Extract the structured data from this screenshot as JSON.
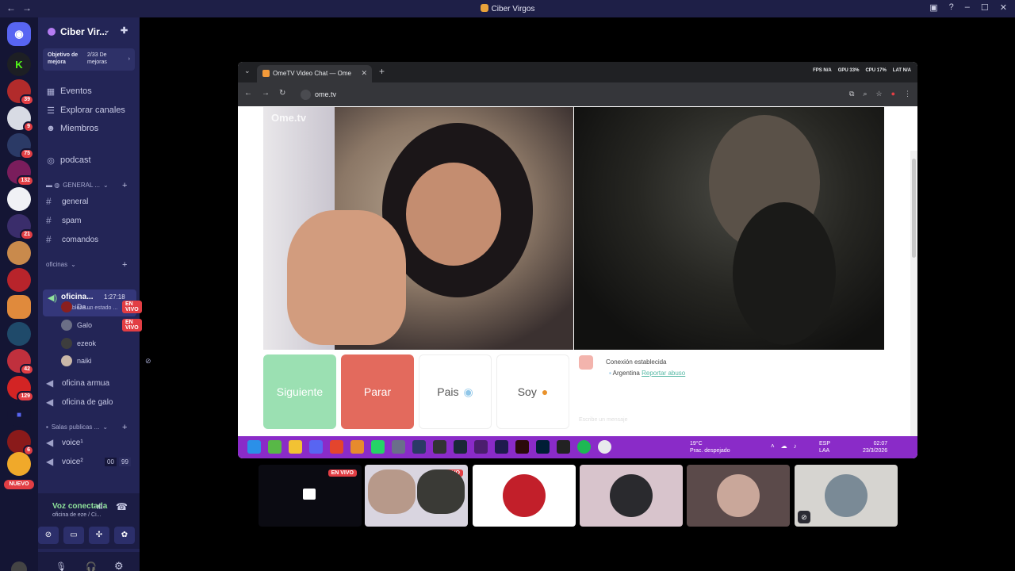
{
  "titlebar": {
    "title": "Ciber Virgos"
  },
  "rail": {
    "badges": [
      "39",
      "9",
      "75",
      "132",
      "21",
      "42",
      "129",
      "6"
    ],
    "nuevo": "NUEVO"
  },
  "sidebar": {
    "server_name": "Ciber Vir...",
    "goal": {
      "label": "Objetivo de mejora",
      "progress": "2/33 De mejoras"
    },
    "nav": [
      {
        "label": "Eventos"
      },
      {
        "label": "Explorar canales"
      },
      {
        "label": "Miembros"
      }
    ],
    "podcast": "podcast",
    "category_general": "GENERAL ...",
    "text_channels": [
      "general",
      "spam",
      "comandos"
    ],
    "category_oficinas": "oficinas",
    "active_voice": {
      "name": "oficina...",
      "time": "1:27:18",
      "status": "Establece un estado ..."
    },
    "voice_users": [
      {
        "name": "Da...",
        "live": "EN VIVO"
      },
      {
        "name": "Galo",
        "live": "EN VIVO"
      },
      {
        "name": "ezeok",
        "live": ""
      },
      {
        "name": "naiki",
        "live": ""
      }
    ],
    "voice_channels": [
      "oficina armua",
      "oficina de galo"
    ],
    "category_salas": "Salas publicas ...",
    "salas": [
      "voice¹",
      "voice²"
    ],
    "sala_counts": [
      "00",
      "99"
    ],
    "voicebar": {
      "status": "Voz conectada",
      "channel": "oficina de eze / Ci..."
    }
  },
  "browser": {
    "tab_title": "OmeTV Video Chat — Ome",
    "url": "ome.tv",
    "perf": [
      "FPS N/A",
      "GPU 33%",
      "CPU 17%",
      "LAT N/A"
    ],
    "logo": "Ome.tv",
    "buttons": {
      "next": "Siguiente",
      "stop": "Parar",
      "country": "Pais",
      "gender": "Soy"
    },
    "chat": {
      "line1": "Conexión establecida",
      "country": "Argentina",
      "report": "Reportar abuso",
      "placeholder": "Escribe un mensaje"
    },
    "taskbar": {
      "temp": "19°C",
      "weather": "Prac. despejado",
      "lang1": "ESP",
      "lang2": "LAA",
      "time": "02:07",
      "date": "23/3/2026"
    }
  },
  "tiles": {
    "live": "EN VIVO"
  },
  "colors": {
    "accent": "#8a2bc8",
    "live": "#e23e44",
    "next": "#9be0b2",
    "stop": "#e36a5d"
  }
}
